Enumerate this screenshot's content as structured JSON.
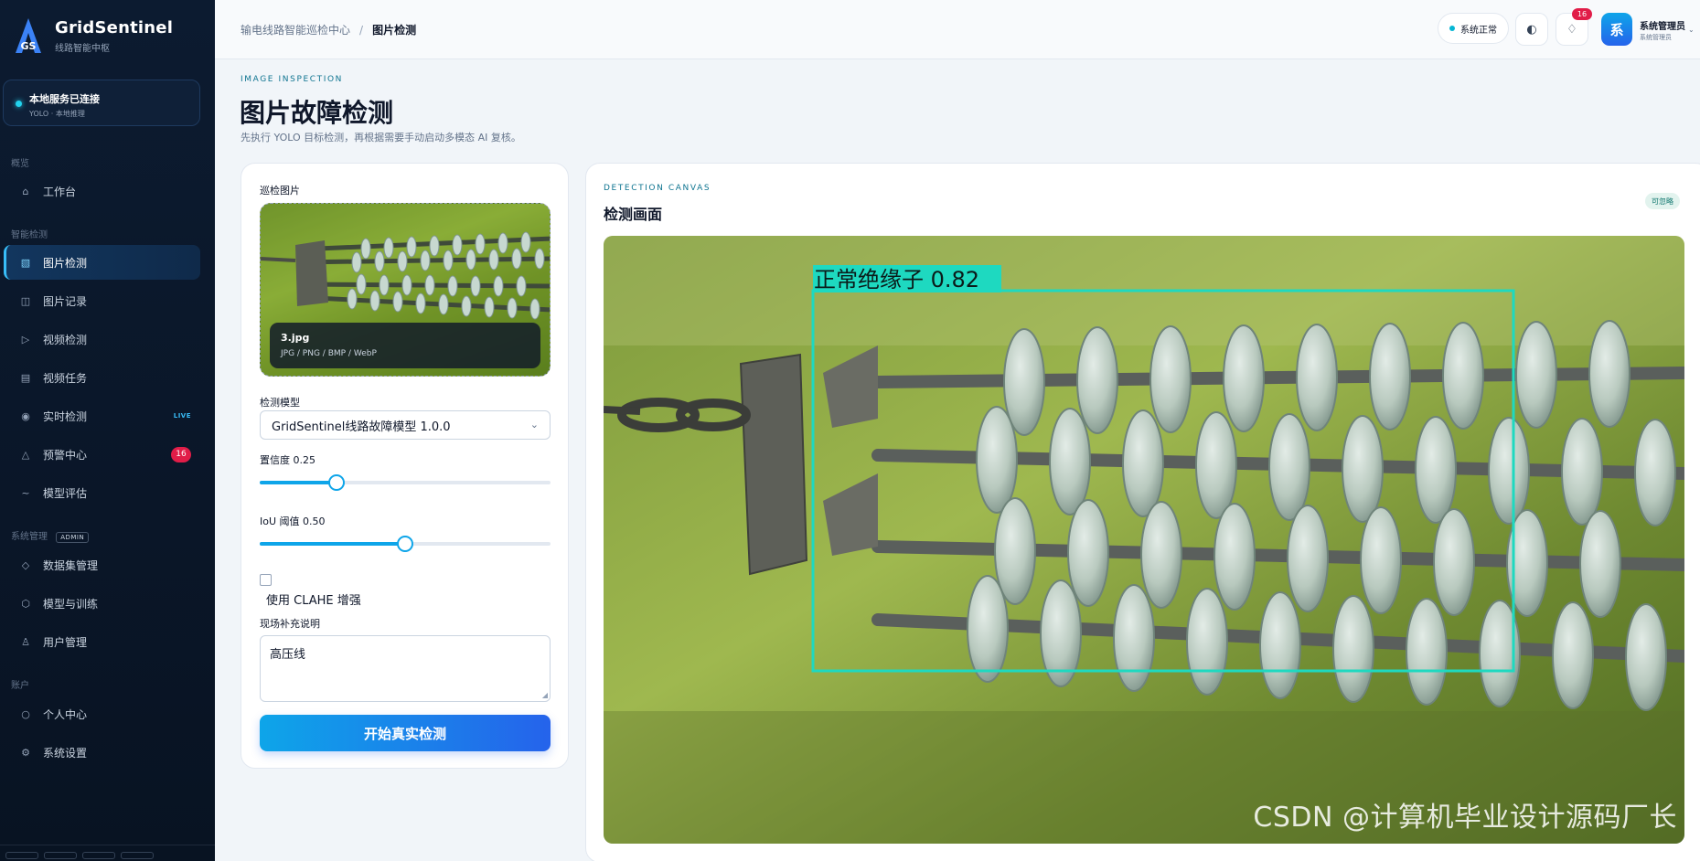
{
  "brand": {
    "name": "GridSentinel",
    "subtitle": "线路智能中枢",
    "logo_text": "GS"
  },
  "service": {
    "title": "本地服务已连接",
    "subtitle": "YOLO · 本地推理"
  },
  "sidebar": {
    "sections": {
      "overview": "概览",
      "detection": "智能检测",
      "system": "系统管理",
      "system_tag": "ADMIN",
      "account": "账户"
    },
    "items": [
      {
        "label": "工作台",
        "icon": "home-icon"
      },
      {
        "label": "图片检测",
        "icon": "image-icon",
        "active": true
      },
      {
        "label": "图片记录",
        "icon": "records-icon"
      },
      {
        "label": "视频检测",
        "icon": "play-icon"
      },
      {
        "label": "视频任务",
        "icon": "list-icon"
      },
      {
        "label": "实时检测",
        "icon": "live-icon",
        "tag": "LIVE"
      },
      {
        "label": "预警中心",
        "icon": "alert-icon",
        "badge": "16"
      },
      {
        "label": "模型评估",
        "icon": "chart-icon"
      },
      {
        "label": "数据集管理",
        "icon": "dataset-icon"
      },
      {
        "label": "模型与训练",
        "icon": "model-icon"
      },
      {
        "label": "用户管理",
        "icon": "user-icon"
      },
      {
        "label": "个人中心",
        "icon": "profile-icon"
      },
      {
        "label": "系统设置",
        "icon": "gear-icon"
      }
    ]
  },
  "topbar": {
    "breadcrumb": [
      "输电线路智能巡检中心",
      "图片检测"
    ],
    "status": "系统正常",
    "notification_count": "16",
    "avatar_letter": "系",
    "user_name": "系统管理员",
    "user_role": "系统管理员"
  },
  "page": {
    "eyebrow": "IMAGE INSPECTION",
    "title": "图片故障检测",
    "subtitle": "先执行 YOLO 目标检测，再根据需要手动启动多模态 AI 复核。"
  },
  "form": {
    "image_label": "巡检图片",
    "file_name": "3.jpg",
    "file_types": "JPG / PNG / BMP / WebP",
    "model_label": "检测模型",
    "model_value": "GridSentinel线路故障模型 1.0.0",
    "confidence_label": "置信度 0.25",
    "confidence": 0.25,
    "iou_label": "IoU 阈值 0.50",
    "iou": 0.5,
    "clahe_label": "使用 CLAHE 增强",
    "clahe_checked": false,
    "notes_label": "现场补充说明",
    "notes_value": "高压线",
    "run_button": "开始真实检测"
  },
  "canvas": {
    "eyebrow": "DETECTION CANVAS",
    "title": "检测画面",
    "tag": "可忽略",
    "detection_label": "正常绝缘子 0.82",
    "watermark": "CSDN @计算机毕业设计源码厂长"
  },
  "colors": {
    "accent": "#0ea5e9",
    "primary": "#2563eb",
    "bbox": "#1ed9c0",
    "badge": "#e11d48"
  }
}
